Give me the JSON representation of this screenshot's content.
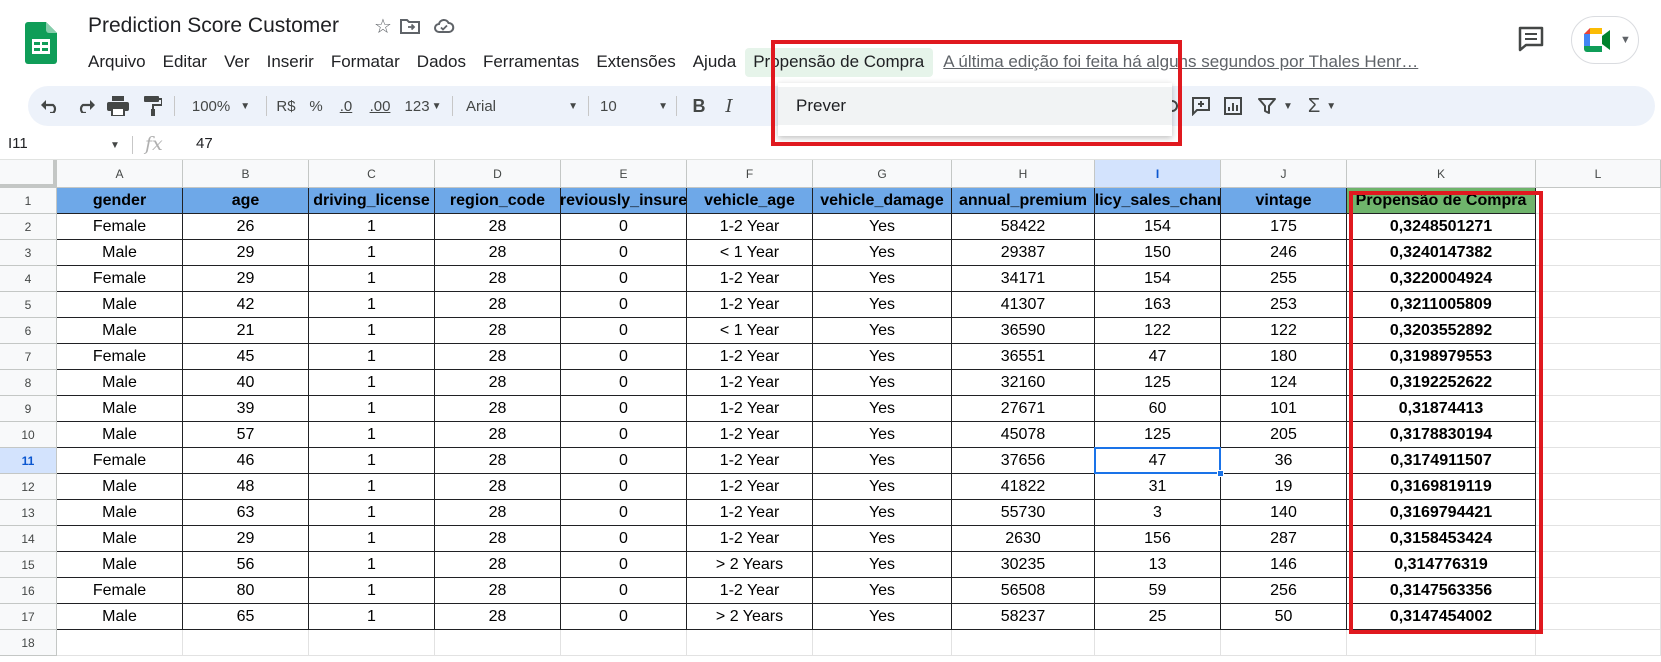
{
  "app": {
    "doc_title": "Prediction Score Customer",
    "last_edit": "A última edição foi feita há alguns segundos por Thales Henr…"
  },
  "menu": {
    "items": [
      "Arquivo",
      "Editar",
      "Ver",
      "Inserir",
      "Formatar",
      "Dados",
      "Ferramentas",
      "Extensões",
      "Ajuda",
      "Propensão de Compra"
    ],
    "active_index": 9
  },
  "dropdown": {
    "items": [
      "Prever"
    ]
  },
  "toolbar": {
    "zoom": "100%",
    "currency": "R$",
    "percent": "%",
    "decrease_decimals": ".0",
    "increase_decimals": ".00",
    "number_format": "123",
    "font": "Arial",
    "font_size": "10",
    "bold": "B",
    "italic": "I",
    "function": "Σ"
  },
  "formula_bar": {
    "cell_ref": "I11",
    "fx": "fx",
    "value": "47"
  },
  "grid": {
    "columns": [
      "A",
      "B",
      "C",
      "D",
      "E",
      "F",
      "G",
      "H",
      "I",
      "J",
      "K",
      "L"
    ],
    "selected_column": "I",
    "selected_row": "11",
    "row_numbers": [
      "1",
      "2",
      "3",
      "4",
      "5",
      "6",
      "7",
      "8",
      "9",
      "10",
      "11",
      "12",
      "13",
      "14",
      "15",
      "16",
      "17",
      "18"
    ],
    "header_row": [
      "gender",
      "age",
      "driving_license",
      "region_code",
      "previously_insured",
      "vehicle_age",
      "vehicle_damage",
      "annual_premium",
      "policy_sales_channel",
      "vintage",
      "Propensão de Compra"
    ],
    "rows": [
      [
        "Female",
        "26",
        "1",
        "28",
        "0",
        "1-2 Year",
        "Yes",
        "58422",
        "154",
        "175",
        "0,3248501271"
      ],
      [
        "Male",
        "29",
        "1",
        "28",
        "0",
        "< 1 Year",
        "Yes",
        "29387",
        "150",
        "246",
        "0,3240147382"
      ],
      [
        "Female",
        "29",
        "1",
        "28",
        "0",
        "1-2 Year",
        "Yes",
        "34171",
        "154",
        "255",
        "0,3220004924"
      ],
      [
        "Male",
        "42",
        "1",
        "28",
        "0",
        "1-2 Year",
        "Yes",
        "41307",
        "163",
        "253",
        "0,3211005809"
      ],
      [
        "Male",
        "21",
        "1",
        "28",
        "0",
        "< 1 Year",
        "Yes",
        "36590",
        "122",
        "122",
        "0,3203552892"
      ],
      [
        "Female",
        "45",
        "1",
        "28",
        "0",
        "1-2 Year",
        "Yes",
        "36551",
        "47",
        "180",
        "0,3198979553"
      ],
      [
        "Male",
        "40",
        "1",
        "28",
        "0",
        "1-2 Year",
        "Yes",
        "32160",
        "125",
        "124",
        "0,3192252622"
      ],
      [
        "Male",
        "39",
        "1",
        "28",
        "0",
        "1-2 Year",
        "Yes",
        "27671",
        "60",
        "101",
        "0,31874413"
      ],
      [
        "Male",
        "57",
        "1",
        "28",
        "0",
        "1-2 Year",
        "Yes",
        "45078",
        "125",
        "205",
        "0,3178830194"
      ],
      [
        "Female",
        "46",
        "1",
        "28",
        "0",
        "1-2 Year",
        "Yes",
        "37656",
        "47",
        "36",
        "0,3174911507"
      ],
      [
        "Male",
        "48",
        "1",
        "28",
        "0",
        "1-2 Year",
        "Yes",
        "41822",
        "31",
        "19",
        "0,3169819119"
      ],
      [
        "Male",
        "63",
        "1",
        "28",
        "0",
        "1-2 Year",
        "Yes",
        "55730",
        "3",
        "140",
        "0,3169794421"
      ],
      [
        "Male",
        "29",
        "1",
        "28",
        "0",
        "1-2 Year",
        "Yes",
        "2630",
        "156",
        "287",
        "0,3158453424"
      ],
      [
        "Male",
        "56",
        "1",
        "28",
        "0",
        "> 2 Years",
        "Yes",
        "30235",
        "13",
        "146",
        "0,314776319"
      ],
      [
        "Female",
        "80",
        "1",
        "28",
        "0",
        "1-2 Year",
        "Yes",
        "56508",
        "59",
        "256",
        "0,3147563356"
      ],
      [
        "Male",
        "65",
        "1",
        "28",
        "0",
        "> 2 Years",
        "Yes",
        "58237",
        "25",
        "50",
        "0,3147454002"
      ]
    ]
  },
  "colors": {
    "header_fill": "#6ea8e8",
    "prediction_header_fill": "#6fb46c",
    "highlight_box": "#e0191f",
    "active_cell": "#1a73e8"
  }
}
